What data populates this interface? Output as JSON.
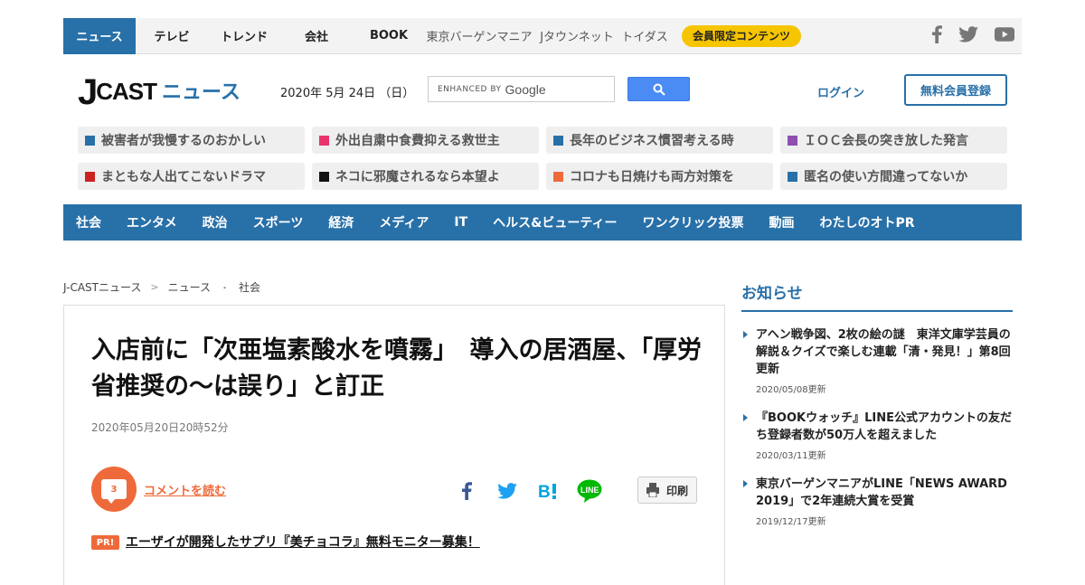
{
  "topnav": {
    "items": [
      {
        "label": "ニュース"
      },
      {
        "label": "テレビ"
      },
      {
        "label": "トレンド"
      },
      {
        "label": "会社"
      },
      {
        "label": "BOOK"
      },
      {
        "label": "東京バーゲンマニア"
      },
      {
        "label": "Jタウンネット"
      },
      {
        "label": "トイダス"
      }
    ],
    "member_badge": "会員限定コンテンツ",
    "social": [
      "facebook-icon",
      "twitter-icon",
      "youtube-icon"
    ]
  },
  "header": {
    "logo_j": "J",
    "logo_cast": "CAST",
    "logo_news": "ニュース",
    "date": "2020年 5月 24日 （日）",
    "search_enhanced": "ENHANCED BY",
    "search_google": "Google",
    "login": "ログイン",
    "register": "無料会員登録"
  },
  "topics": [
    {
      "label": "被害者が我慢するのおかしい",
      "color": "#2870a8"
    },
    {
      "label": "外出自粛中食費抑える救世主",
      "color": "#e8336d"
    },
    {
      "label": "長年のビジネス慣習考える時",
      "color": "#2870a8"
    },
    {
      "label": "ＩＯＣ会長の突き放した発言",
      "color": "#8e4fae"
    },
    {
      "label": "まともな人出てこないドラマ",
      "color": "#cc2222"
    },
    {
      "label": "ネコに邪魔されるなら本望よ",
      "color": "#111111"
    },
    {
      "label": "コロナも日焼けも両方対策を",
      "color": "#ef6a3a"
    },
    {
      "label": "匿名の使い方間違ってないか",
      "color": "#2870a8"
    }
  ],
  "categories": [
    "社会",
    "エンタメ",
    "政治",
    "スポーツ",
    "経済",
    "メディア",
    "IT",
    "ヘルス&ビューティー",
    "ワンクリック投票",
    "動画",
    "わたしのオトPR"
  ],
  "breadcrumb": [
    "J-CASTニュース",
    "ニュース",
    "社会"
  ],
  "article": {
    "title": "入店前に「次亜塩素酸水を噴霧」　導入の居酒屋、「厚労省推奨の～は誤り」と訂正",
    "date": "2020年05月20日20時52分",
    "comment_count": "3",
    "comment_link": "コメントを読む",
    "print": "印刷",
    "pr_badge": "PR!",
    "pr_link": "エーザイが開発したサプリ『美チョコラ』無料モニター募集！"
  },
  "sidebar": {
    "title": "お知らせ",
    "notices": [
      {
        "title": "アヘン戦争図、2枚の絵の謎　東洋文庫学芸員の解説＆クイズで楽しむ連載「清・発見！」第8回更新",
        "date": "2020/05/08更新"
      },
      {
        "title": "『BOOKウォッチ』LINE公式アカウントの友だち登録者数が50万人を超えました",
        "date": "2020/03/11更新"
      },
      {
        "title": "東京バーゲンマニアがLINE「NEWS AWARD 2019」で2年連続大賞を受賞",
        "date": "2019/12/17更新"
      }
    ]
  },
  "colors": {
    "brand_blue": "#2870a8",
    "accent_orange": "#ef6a3a",
    "badge_yellow": "#f6c500"
  }
}
